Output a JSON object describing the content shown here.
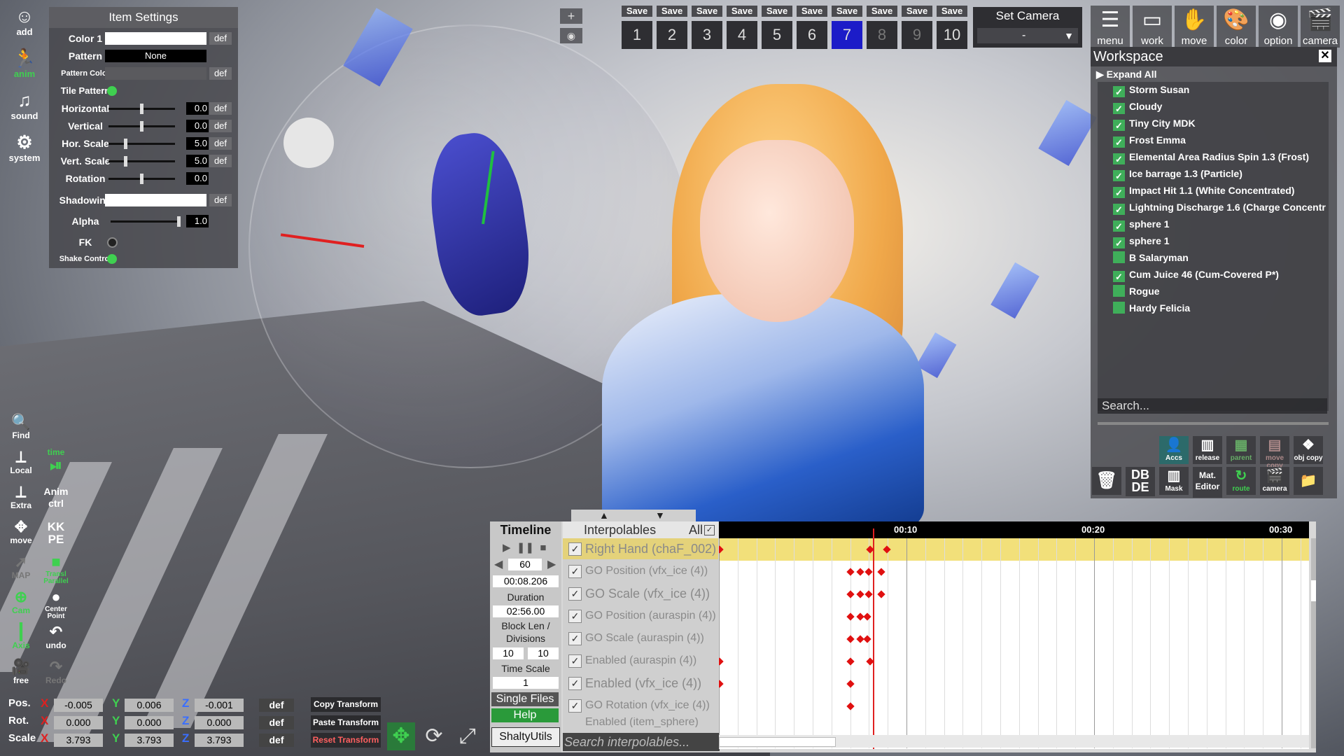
{
  "item_settings": {
    "title": "Item Settings",
    "color1_label": "Color 1",
    "pattern_label": "Pattern",
    "pattern_value": "None",
    "pattern_color_label": "Pattern Color",
    "tile_pattern_label": "Tile Pattern",
    "horizontal_label": "Horizontal",
    "horizontal_value": "0.0",
    "vertical_label": "Vertical",
    "vertical_value": "0.0",
    "hor_scale_label": "Hor. Scale",
    "hor_scale_value": "5.0",
    "vert_scale_label": "Vert. Scale",
    "vert_scale_value": "5.0",
    "rotation_label": "Rotation",
    "rotation_value": "0.0",
    "shadowing_label": "Shadowing",
    "alpha_label": "Alpha",
    "alpha_value": "1.0",
    "fk_label": "FK",
    "shake_control_label": "Shake Control",
    "def_label": "def"
  },
  "left_toolbar": {
    "add": "add",
    "anim": "anim",
    "sound": "sound",
    "system": "system",
    "find": "Find",
    "local": "Local",
    "time": "time",
    "extra": "Extra",
    "anim_ctrl": "Anim ctrl",
    "move": "move",
    "kkpe": "KK PE",
    "map": "MAP",
    "transl_parallel": "Transl Parallel",
    "cam": "Cam",
    "center_point": "Center Point",
    "axis": "Axis",
    "undo": "undo",
    "free": "free",
    "redo": "Redo"
  },
  "transform": {
    "pos_label": "Pos.",
    "rot_label": "Rot.",
    "scale_label": "Scale",
    "x": "X",
    "y": "Y",
    "z": "Z",
    "pos": [
      "-0.005",
      "0.006",
      "-0.001"
    ],
    "rot": [
      "0.000",
      "0.000",
      "0.000"
    ],
    "scale": [
      "3.793",
      "3.793",
      "3.793"
    ],
    "def_label": "def",
    "copy_transform": "Copy Transform",
    "paste_transform": "Paste Transform",
    "reset_transform": "Reset Transform"
  },
  "top_bar": {
    "plus": "+",
    "save_label": "Save",
    "slots": [
      "1",
      "2",
      "3",
      "4",
      "5",
      "6",
      "7",
      "8",
      "9",
      "10"
    ],
    "set_camera_label": "Set Camera",
    "set_camera_value": "-",
    "menu": "menu",
    "work": "work",
    "move": "move",
    "color": "color",
    "option": "option",
    "camera": "camera"
  },
  "workspace": {
    "title": "Workspace",
    "close": "✕",
    "expand_all": "Expand All",
    "items": [
      "Storm Susan",
      "Cloudy",
      "Tiny City MDK",
      "Frost Emma",
      "Elemental Area Radius Spin 1.3 (Frost)",
      "Ice barrage 1.3 (Particle)",
      "Impact Hit 1.1 (White Concentrated)",
      "Lightning Discharge 1.6 (Charge Concentr",
      "sphere 1",
      "sphere 1",
      "B Salaryman",
      "Cum Juice 46 (Cum-Covered P*)",
      "Rogue",
      "Hardy Felicia"
    ],
    "search_placeholder": "Search...",
    "buttons": [
      "Accs",
      "release",
      "parent",
      "move copy",
      "obj copy",
      "DB DE",
      "Mask",
      "Mat. Editor",
      "route",
      "camera"
    ]
  },
  "timeline": {
    "title": "Timeline",
    "interpolables_label": "Interpolables",
    "all_label": "All",
    "fps": "60",
    "current_time": "00:08.206",
    "duration_label": "Duration",
    "duration_value": "02:56.00",
    "block_len_label": "Block Len / Divisions",
    "block_len": "10",
    "divisions": "10",
    "time_scale_label": "Time Scale",
    "time_scale_value": "1",
    "single_files": "Single Files",
    "help": "Help",
    "shaltyutils": "ShaltyUtils",
    "search_placeholder": "Search interpolables...",
    "ticks": [
      "00:10",
      "00:20",
      "00:30"
    ],
    "interpolables": [
      "Right Hand (chaF_002)",
      "GO Position (vfx_ice (4))",
      "GO Scale (vfx_ice (4))",
      "GO Position (auraspin (4))",
      "GO Scale (auraspin (4))",
      "Enabled (auraspin (4))",
      "Enabled (vfx_ice (4))",
      "GO Rotation (vfx_ice (4))",
      "Enabled (item_sphere)"
    ]
  }
}
